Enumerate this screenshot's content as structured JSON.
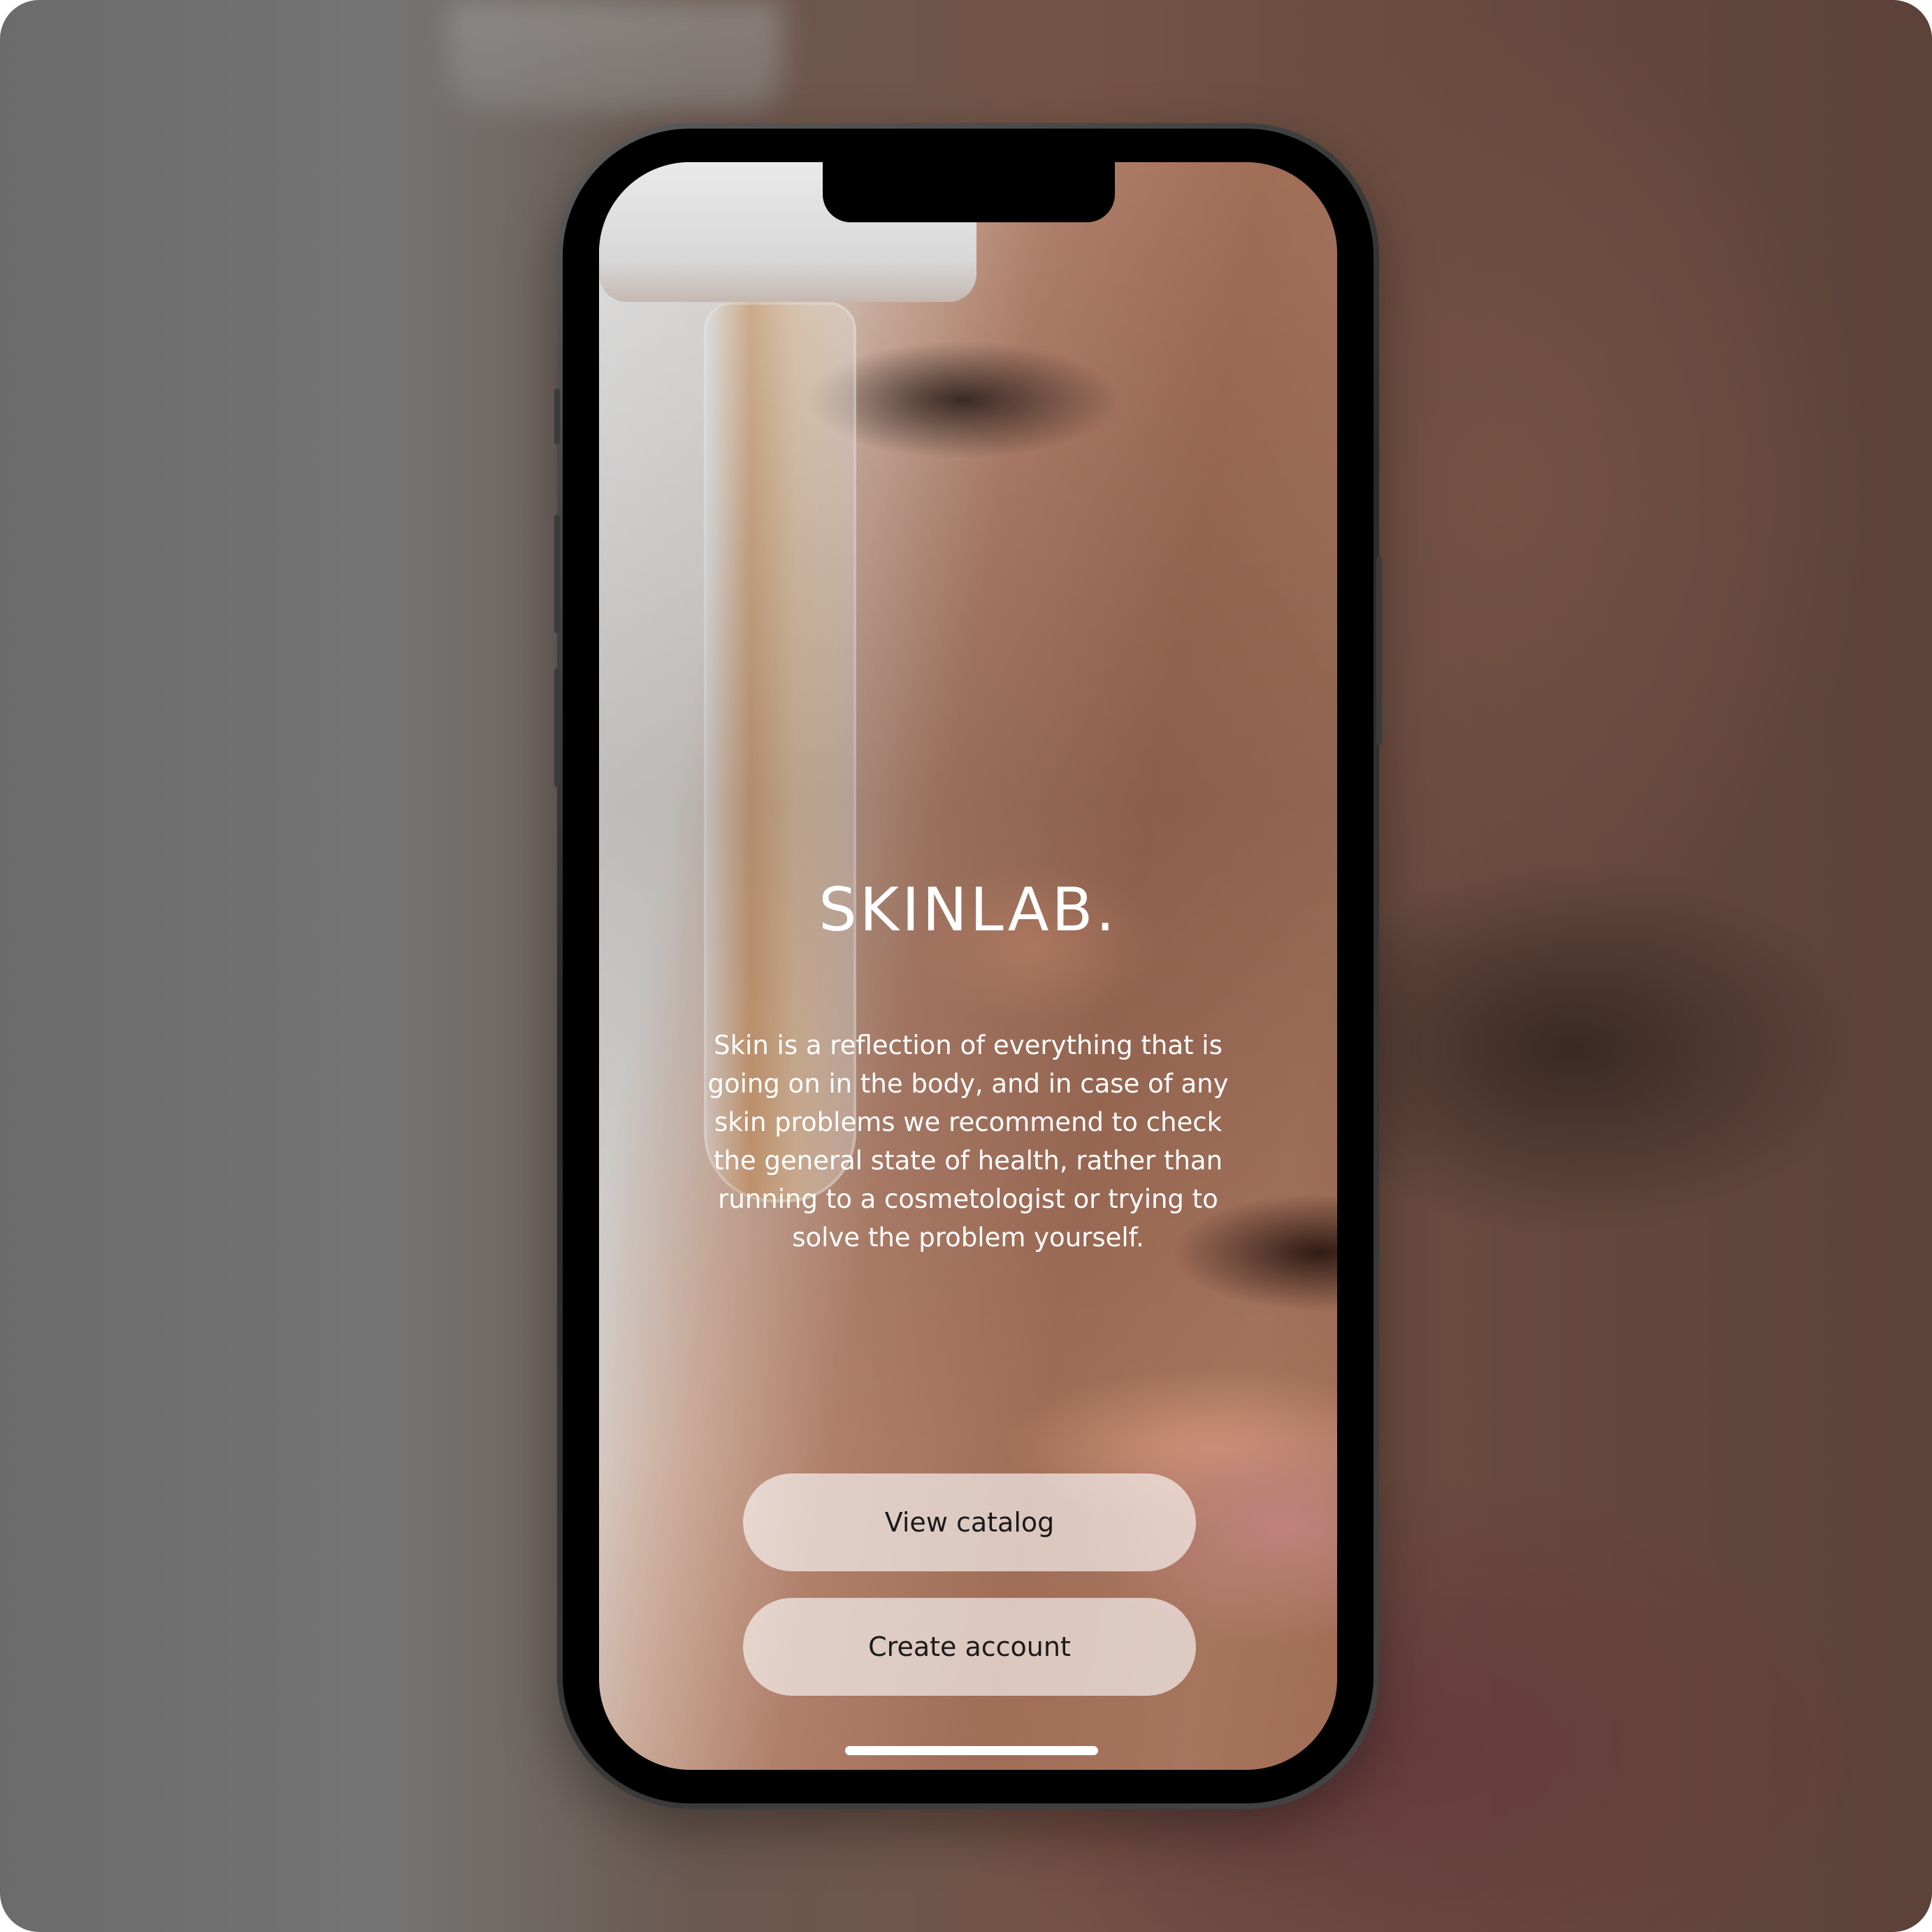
{
  "app": {
    "brand": "SKINLAB.",
    "tagline": "Skin is a reflection of everything that is going on in the body, and in case of any skin problems we recommend to check the general state of health, rather than running to a cosmetologist or trying to solve the problem yourself."
  },
  "actions": {
    "view_catalog_label": "View catalog",
    "create_account_label": "Create account"
  },
  "colors": {
    "button_bg": "#ffffffa0",
    "button_text": "#1a1a1a",
    "text_on_image": "#ffffff"
  }
}
